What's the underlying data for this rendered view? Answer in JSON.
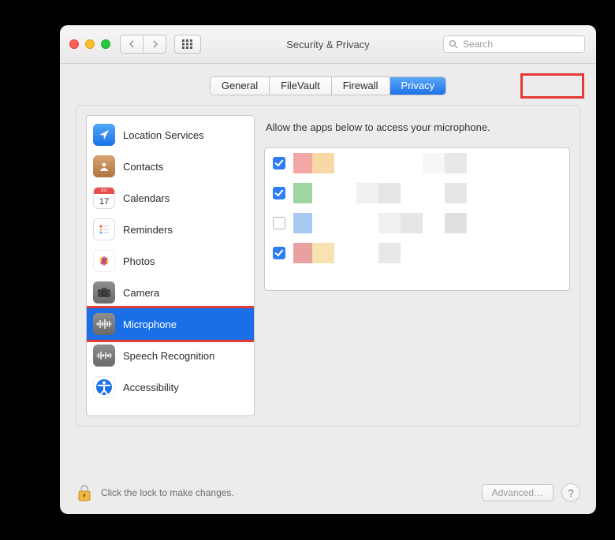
{
  "window": {
    "title": "Security & Privacy",
    "search_placeholder": "Search"
  },
  "tabs": [
    {
      "id": "general",
      "label": "General",
      "selected": false
    },
    {
      "id": "filevault",
      "label": "FileVault",
      "selected": false
    },
    {
      "id": "firewall",
      "label": "Firewall",
      "selected": false
    },
    {
      "id": "privacy",
      "label": "Privacy",
      "selected": true,
      "highlighted": true
    }
  ],
  "sidebar": {
    "items": [
      {
        "id": "location",
        "label": "Location Services",
        "icon": "location-icon",
        "selected": false
      },
      {
        "id": "contacts",
        "label": "Contacts",
        "icon": "contacts-icon",
        "selected": false
      },
      {
        "id": "calendars",
        "label": "Calendars",
        "icon": "calendar-icon",
        "selected": false
      },
      {
        "id": "reminders",
        "label": "Reminders",
        "icon": "reminders-icon",
        "selected": false
      },
      {
        "id": "photos",
        "label": "Photos",
        "icon": "photos-icon",
        "selected": false
      },
      {
        "id": "camera",
        "label": "Camera",
        "icon": "camera-icon",
        "selected": false
      },
      {
        "id": "microphone",
        "label": "Microphone",
        "icon": "microphone-icon",
        "selected": true,
        "highlighted": true
      },
      {
        "id": "speech",
        "label": "Speech Recognition",
        "icon": "speech-icon",
        "selected": false
      },
      {
        "id": "accessibility",
        "label": "Accessibility",
        "icon": "accessibility-icon",
        "selected": false
      }
    ]
  },
  "content": {
    "description": "Allow the apps below to access your microphone.",
    "apps": [
      {
        "checked": true,
        "blur_colors": [
          "#f2a6a6",
          "#f7d9a6",
          "#fff",
          "#fff",
          "#fff",
          "#fff",
          "#f7f7f7",
          "#e8e8e8",
          "#fff"
        ]
      },
      {
        "checked": true,
        "blur_colors": [
          "#9fd59f",
          "#fff",
          "#fff",
          "#f0f0f0",
          "#e5e5e5",
          "#fff",
          "#fff",
          "#e6e6e6",
          "#fff"
        ]
      },
      {
        "checked": false,
        "blur_colors": [
          "#a8c9f0",
          "#fff",
          "#fff",
          "#fff",
          "#f0f0f0",
          "#e6e6e6",
          "#fff",
          "#e0e0e0",
          "#fff"
        ]
      },
      {
        "checked": true,
        "blur_colors": [
          "#e8a0a0",
          "#f6e3b0",
          "#fff",
          "#fff",
          "#e8e8e8",
          "#fff",
          "#fff",
          "#fff",
          "#fff"
        ]
      }
    ]
  },
  "footer": {
    "lock_text": "Click the lock to make changes.",
    "advanced_label": "Advanced…",
    "help_label": "?"
  },
  "highlight_color": "#e53935"
}
